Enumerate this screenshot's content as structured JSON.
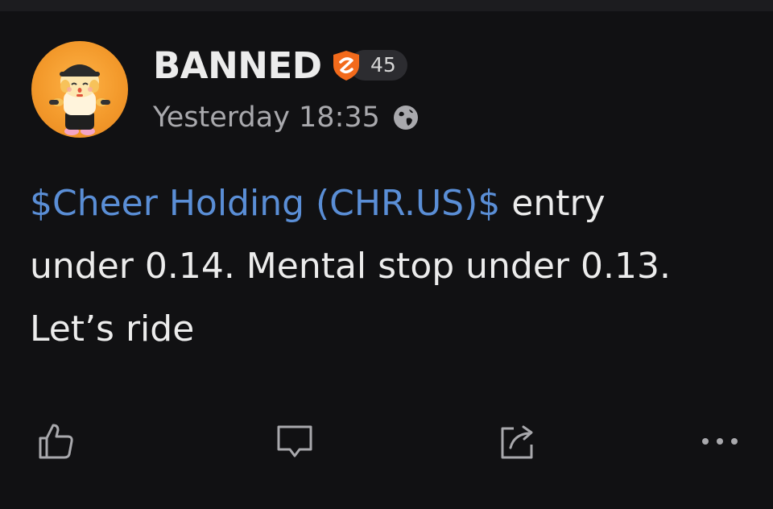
{
  "post": {
    "author": {
      "username": "BANNED",
      "badge_level": "45",
      "timestamp": "Yesterday 18:35"
    },
    "content": {
      "stock_link": "$Cheer Holding (CHR.US)$",
      "text_line1": " entry",
      "text_line2": "under 0.14. Mental stop under 0.13.",
      "text_line3": "Let’s ride"
    },
    "actions": [
      {
        "name": "like",
        "icon": "thumbs-up-icon"
      },
      {
        "name": "comment",
        "icon": "comment-icon"
      },
      {
        "name": "share",
        "icon": "share-icon"
      },
      {
        "name": "more",
        "icon": "more-horizontal-icon"
      }
    ]
  },
  "colors": {
    "background": "#111113",
    "text_primary": "#ececec",
    "text_secondary": "#a9a9ad",
    "link": "#5a8ed6",
    "badge_orange": "#f26a1b",
    "avatar_orange": "#f39a2c"
  }
}
